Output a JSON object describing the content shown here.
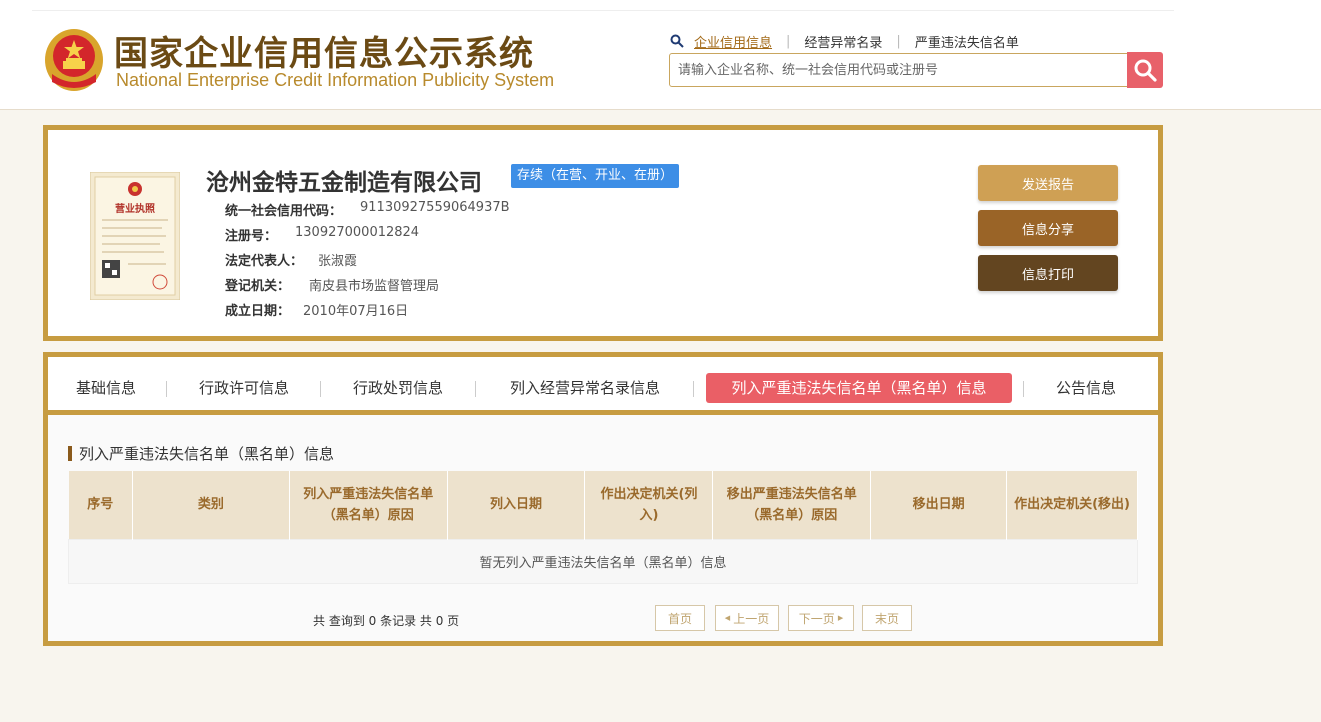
{
  "header": {
    "title_cn": "国家企业信用信息公示系统",
    "title_en": "National Enterprise Credit Information Publicity System",
    "nav": [
      {
        "label": "企业信用信息",
        "active": true
      },
      {
        "label": "经营异常名录",
        "active": false
      },
      {
        "label": "严重违法失信名单",
        "active": false
      }
    ],
    "search_placeholder": "请输入企业名称、统一社会信用代码或注册号"
  },
  "company": {
    "name": "沧州金特五金制造有限公司",
    "status": "存续（在营、开业、在册）",
    "fields": [
      {
        "label": "统一社会信用代码：",
        "value": "91130927559064937B"
      },
      {
        "label": "注册号：",
        "value": "130927000012824"
      },
      {
        "label": "法定代表人：",
        "value": "张淑霞"
      },
      {
        "label": "登记机关：",
        "value": "南皮县市场监督管理局"
      },
      {
        "label": "成立日期：",
        "value": "2010年07月16日"
      }
    ],
    "license_title": "营业执照"
  },
  "actions": {
    "report": "发送报告",
    "share": "信息分享",
    "print": "信息打印"
  },
  "tabs": [
    {
      "label": "基础信息",
      "active": false
    },
    {
      "label": "行政许可信息",
      "active": false
    },
    {
      "label": "行政处罚信息",
      "active": false
    },
    {
      "label": "列入经营异常名录信息",
      "active": false
    },
    {
      "label": "列入严重违法失信名单（黑名单）信息",
      "active": true
    },
    {
      "label": "公告信息",
      "active": false
    }
  ],
  "section": {
    "title": "列入严重违法失信名单（黑名单）信息",
    "columns": [
      "序号",
      "类别",
      "列入严重违法失信名单（黑名单）原因",
      "列入日期",
      "作出决定机关(列入)",
      "移出严重违法失信名单（黑名单）原因",
      "移出日期",
      "作出决定机关(移出)"
    ],
    "empty_text": "暂无列入严重违法失信名单（黑名单）信息"
  },
  "pagination": {
    "summary": "共 查询到 0 条记录 共 0 页",
    "first": "首页",
    "prev": "上一页",
    "next": "下一页",
    "last": "末页"
  },
  "colors": {
    "gold_border": "#c79c41",
    "brand_brown": "#6b4a14",
    "active_tab": "#ea5f66",
    "status_blue": "#3d8ee6"
  }
}
